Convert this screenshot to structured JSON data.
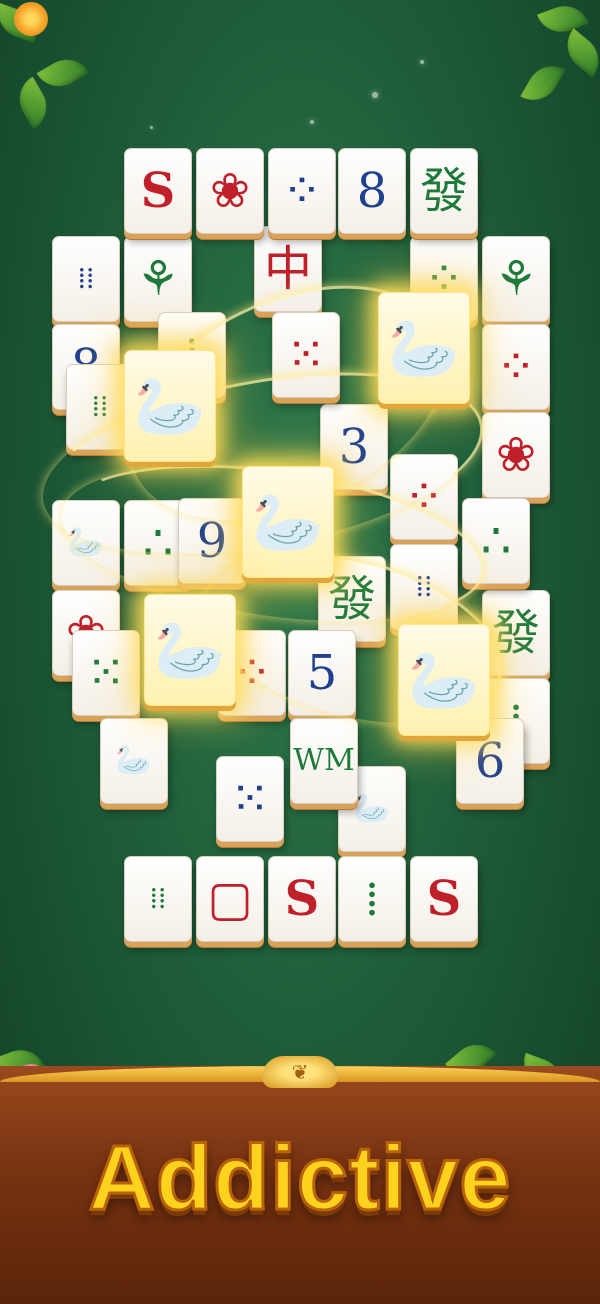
{
  "banner": {
    "title": "Addictive"
  },
  "colors": {
    "background": "#1f5e3a",
    "banner": "#7a3412",
    "title": "#ffd21e",
    "red": "#c0202a",
    "green": "#1e7a3a",
    "blue": "#1f3f8f"
  },
  "tiles": [
    {
      "id": "r1c1",
      "glyph": "S",
      "color": "#c0202a",
      "layer": "top"
    },
    {
      "id": "r1c2",
      "glyph": "❀",
      "color": "#c0202a",
      "layer": "top"
    },
    {
      "id": "r1c3",
      "glyph": "⁘",
      "color": "#1f3f8f",
      "layer": "top"
    },
    {
      "id": "r1c4",
      "glyph": "8",
      "color": "#1f3f8f",
      "layer": "top"
    },
    {
      "id": "r1c5",
      "glyph": "發",
      "color": "#1e7a3a",
      "layer": "top"
    },
    {
      "id": "r2c1",
      "glyph": "⁞⁞",
      "color": "#1f3f8f",
      "layer": "mid"
    },
    {
      "id": "r2c2",
      "glyph": "⚘",
      "color": "#1e7a3a",
      "layer": "mid"
    },
    {
      "id": "r2c3",
      "glyph": "中",
      "color": "#c0202a",
      "layer": "upper"
    },
    {
      "id": "r2c5",
      "glyph": "⁘",
      "color": "#1e7a3a",
      "layer": "mid"
    },
    {
      "id": "r2c6",
      "glyph": "⚘",
      "color": "#1e7a3a",
      "layer": "mid"
    },
    {
      "id": "r3c1",
      "glyph": "8",
      "color": "#1f3f8f",
      "layer": "mid"
    },
    {
      "id": "r3c3",
      "glyph": "⁞",
      "color": "#1e7a3a",
      "layer": "mid"
    },
    {
      "id": "r3c4",
      "glyph": "⁙",
      "color": "#c0202a",
      "layer": "upper"
    },
    {
      "id": "r3c6",
      "glyph": "⁘",
      "color": "#c0202a",
      "layer": "mid"
    },
    {
      "id": "r4c1",
      "glyph": "⁞⁞",
      "color": "#1e7a3a",
      "layer": "mid"
    },
    {
      "id": "r4c4",
      "glyph": "3",
      "color": "#1f3f8f",
      "layer": "mid"
    },
    {
      "id": "r4c6",
      "glyph": "❀",
      "color": "#c0202a",
      "layer": "mid"
    },
    {
      "id": "r5c1",
      "glyph": "🦢",
      "color": "#c0202a",
      "layer": "mid"
    },
    {
      "id": "r5c2",
      "glyph": "∴",
      "color": "#1e7a3a",
      "layer": "mid"
    },
    {
      "id": "r5c3",
      "glyph": "9",
      "color": "#1f3f8f",
      "layer": "upper"
    },
    {
      "id": "r5c5",
      "glyph": "⁘",
      "color": "#c0202a",
      "layer": "mid"
    },
    {
      "id": "r5c6",
      "glyph": "∴",
      "color": "#1e7a3a",
      "layer": "upper"
    },
    {
      "id": "r6c1",
      "glyph": "❀",
      "color": "#c0202a",
      "layer": "mid"
    },
    {
      "id": "r6c4",
      "glyph": "發",
      "color": "#1e7a3a",
      "layer": "mid"
    },
    {
      "id": "r6c5",
      "glyph": "⁞⁞",
      "color": "#1f3f8f",
      "layer": "mid"
    },
    {
      "id": "r6c6",
      "glyph": "發",
      "color": "#1e7a3a",
      "layer": "mid"
    },
    {
      "id": "r7c1",
      "glyph": "⁙",
      "color": "#1e7a3a",
      "layer": "upper"
    },
    {
      "id": "r7c3",
      "glyph": "⁘",
      "color": "#c0202a",
      "layer": "mid"
    },
    {
      "id": "r7c4",
      "glyph": "5",
      "color": "#1f3f8f",
      "layer": "mid"
    },
    {
      "id": "r7c6",
      "glyph": "⁞",
      "color": "#1e7a3a",
      "layer": "mid"
    },
    {
      "id": "r8c1",
      "glyph": "🦢",
      "color": "#c0202a",
      "layer": "upper"
    },
    {
      "id": "r8c3",
      "glyph": "⁙",
      "color": "#1f3f8f",
      "layer": "upper"
    },
    {
      "id": "r8c4",
      "glyph": "WM",
      "color": "#1e7a3a",
      "layer": "upper"
    },
    {
      "id": "r8c5",
      "glyph": "🦢",
      "color": "#c0202a",
      "layer": "mid"
    },
    {
      "id": "r8c6",
      "glyph": "6",
      "color": "#1f3f8f",
      "layer": "upper"
    },
    {
      "id": "r9c1",
      "glyph": "⁞⁞",
      "color": "#1e7a3a",
      "layer": "top"
    },
    {
      "id": "r9c2",
      "glyph": "▢",
      "color": "#c0202a",
      "layer": "top"
    },
    {
      "id": "r9c3",
      "glyph": "S",
      "color": "#c0202a",
      "layer": "top"
    },
    {
      "id": "r9c4",
      "glyph": "⁞",
      "color": "#1e7a3a",
      "layer": "top"
    },
    {
      "id": "r9c5",
      "glyph": "S",
      "color": "#c0202a",
      "layer": "top"
    }
  ],
  "glow_tiles": [
    {
      "id": "g1",
      "glyph": "🦢",
      "color": "#c0202a"
    },
    {
      "id": "g2",
      "glyph": "🦢",
      "color": "#c0202a"
    },
    {
      "id": "g3",
      "glyph": "🦢",
      "color": "#c0202a"
    },
    {
      "id": "g4",
      "glyph": "🦢",
      "color": "#c0202a"
    },
    {
      "id": "g5",
      "glyph": "🦢",
      "color": "#c0202a"
    }
  ]
}
